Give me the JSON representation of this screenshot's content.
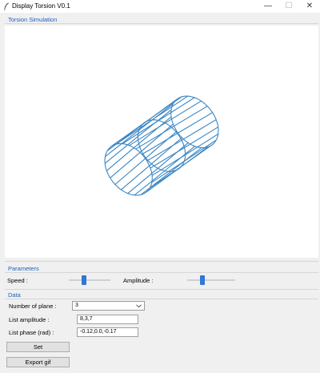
{
  "window": {
    "title": "Display Torsion V0.1",
    "minimize_glyph": "—",
    "maximize_glyph": "☐",
    "close_glyph": "✕"
  },
  "simulation": {
    "label": "Torsion Simulation"
  },
  "parameters": {
    "label": "Parameters",
    "speed_label": "Speed :",
    "speed_value": 0.35,
    "amplitude_label": "Amplitude :",
    "amplitude_value": 0.3
  },
  "data": {
    "label": "Data",
    "num_plane_label": "Number of plane :",
    "num_plane_value": "3",
    "list_amplitude_label": "List amplitude :",
    "list_amplitude_value": "8,3,7",
    "list_phase_label": "List phase (rad) :",
    "list_phase_value": "-0.12,0.0,-0.17",
    "set_label": "Set",
    "export_label": "Export gif"
  },
  "colors": {
    "accent": "#2e78d8",
    "section_label": "#1f5fbf",
    "wireframe": "#3b86c4"
  },
  "icons": {
    "app": "feather-icon",
    "combo": "chevron-down-icon"
  }
}
